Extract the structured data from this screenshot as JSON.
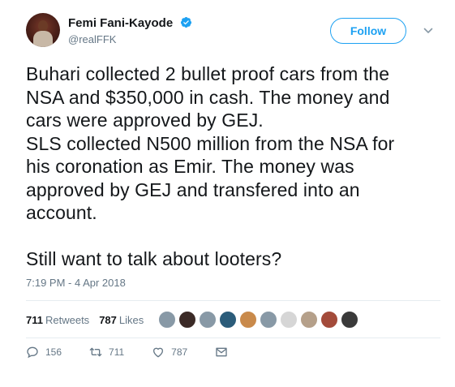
{
  "author": {
    "display_name": "Femi Fani-Kayode",
    "handle": "@realFFK",
    "verified_icon": "verified-badge-icon"
  },
  "follow_button": {
    "label": "Follow"
  },
  "tweet": {
    "lines": [
      "Buhari collected 2 bullet proof cars from the",
      "NSA and $350,000 in cash. The money and",
      "cars were approved by GEJ.",
      "SLS collected N500 million from the NSA for",
      "his coronation as Emir. The money was",
      "approved by GEJ and transfered into an",
      "account."
    ],
    "closing": "Still want to talk about looters?",
    "timestamp": "7:19 PM - 4 Apr 2018"
  },
  "stats": {
    "retweets_count": "711",
    "retweets_label": "Retweets",
    "likes_count": "787",
    "likes_label": "Likes"
  },
  "liker_avatars": [
    {
      "color": "#8899a6"
    },
    {
      "color": "#3b2a26"
    },
    {
      "color": "#8899a6"
    },
    {
      "color": "#2b5c7a"
    },
    {
      "color": "#c98a4b"
    },
    {
      "color": "#8899a6"
    },
    {
      "color": "#d6d6d6"
    },
    {
      "color": "#b5a08a"
    },
    {
      "color": "#a34b3a"
    },
    {
      "color": "#3a3a3a"
    }
  ],
  "actions": {
    "replies": "156",
    "retweets": "711",
    "likes": "787"
  },
  "colors": {
    "accent": "#1da1f2",
    "muted": "#657786",
    "text": "#14171a"
  }
}
